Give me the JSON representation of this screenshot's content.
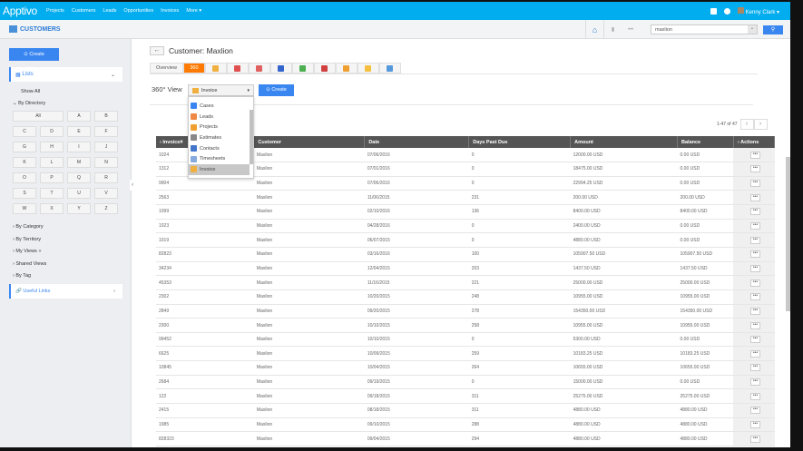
{
  "topbar": {
    "logo": "Apptivo",
    "nav": [
      "Projects",
      "Customers",
      "Leads",
      "Opportunities",
      "Invoices",
      "More ▾"
    ],
    "user": "Kenny Clark ▾"
  },
  "subheader": {
    "title": "CUSTOMERS",
    "search_value": "maxlion",
    "dots": "•••"
  },
  "sidebar": {
    "create": "Create",
    "lists": "Lists",
    "show_all": "Show All",
    "by_directory": "By Directory",
    "letters": [
      "All",
      "A",
      "B",
      "C",
      "D",
      "E",
      "F",
      "G",
      "H",
      "I",
      "J",
      "K",
      "L",
      "M",
      "N",
      "O",
      "P",
      "Q",
      "R",
      "S",
      "T",
      "U",
      "V",
      "W",
      "X",
      "Y",
      "Z"
    ],
    "sections": [
      "By Category",
      "By Territory",
      "My Views",
      "Shared Views",
      "By Tag"
    ],
    "useful_links": "Useful Links"
  },
  "main": {
    "title": "Customer: Maxlion",
    "tabs": [
      "Overview",
      "360"
    ],
    "view_label": "360° View",
    "selected_view": "Invoice",
    "create": "Create",
    "menu": [
      "Cases",
      "Leads",
      "Projects",
      "Estimates",
      "Contacts",
      "Timesheets",
      "Invoice"
    ],
    "pager": "1-47 of 47",
    "columns": [
      "Invoice#",
      "Customer",
      "Date",
      "Days Past Due",
      "Amount",
      "Balance",
      "Actions"
    ],
    "rows": [
      [
        "1024",
        "Maxlion",
        "07/06/2016",
        "0",
        "12000.00 USD",
        "0.00 USD"
      ],
      [
        "1312",
        "Maxlion",
        "07/01/2016",
        "0",
        "18475.00 USD",
        "0.00 USD"
      ],
      [
        "9904",
        "Maxlion",
        "07/06/2016",
        "0",
        "22994.25 USD",
        "0.00 USD"
      ],
      [
        "2563",
        "Maxlion",
        "11/06/2015",
        "231",
        "200.00 USD",
        "200.00 USD"
      ],
      [
        "1099",
        "Maxlion",
        "02/10/2016",
        "136",
        "8400.00 USD",
        "8400.00 USD"
      ],
      [
        "1023",
        "Maxlion",
        "04/28/2016",
        "0",
        "2400.00 USD",
        "0.00 USD"
      ],
      [
        "1019",
        "Maxlion",
        "06/07/2015",
        "0",
        "4880.00 USD",
        "0.00 USD"
      ],
      [
        "82823",
        "Maxlion",
        "03/16/2016",
        "100",
        "105907.50 USD",
        "105907.50 USD"
      ],
      [
        "34234",
        "Maxlion",
        "12/04/2015",
        "203",
        "1437.50 USD",
        "1437.50 USD"
      ],
      [
        "45353",
        "Maxlion",
        "11/16/2015",
        "221",
        "25000.00 USD",
        "25000.00 USD"
      ],
      [
        "2302",
        "Maxlion",
        "10/20/2015",
        "248",
        "10955.00 USD",
        "10955.00 USD"
      ],
      [
        "2849",
        "Maxlion",
        "09/20/2015",
        "278",
        "154350.00 USD",
        "154350.00 USD"
      ],
      [
        "2300",
        "Maxlion",
        "10/10/2015",
        "258",
        "10955.00 USD",
        "10955.00 USD"
      ],
      [
        "99452",
        "Maxlion",
        "10/10/2015",
        "0",
        "5300.00 USD",
        "0.00 USD"
      ],
      [
        "6625",
        "Maxlion",
        "10/09/2015",
        "259",
        "10183.25 USD",
        "10183.25 USD"
      ],
      [
        "10845",
        "Maxlion",
        "10/04/2015",
        "264",
        "10655.00 USD",
        "10655.00 USD"
      ],
      [
        "2684",
        "Maxlion",
        "09/19/2015",
        "0",
        "15000.00 USD",
        "0.00 USD"
      ],
      [
        "122",
        "Maxlion",
        "09/18/2015",
        "311",
        "25275.00 USD",
        "25275.00 USD"
      ],
      [
        "2415",
        "Maxlion",
        "08/18/2015",
        "311",
        "4880.00 USD",
        "4880.00 USD"
      ],
      [
        "1985",
        "Maxlion",
        "09/10/2015",
        "288",
        "4880.00 USD",
        "4880.00 USD"
      ],
      [
        "828323",
        "Maxlion",
        "09/04/2015",
        "294",
        "4880.00 USD",
        "4880.00 USD"
      ]
    ],
    "action_label": "•••"
  }
}
